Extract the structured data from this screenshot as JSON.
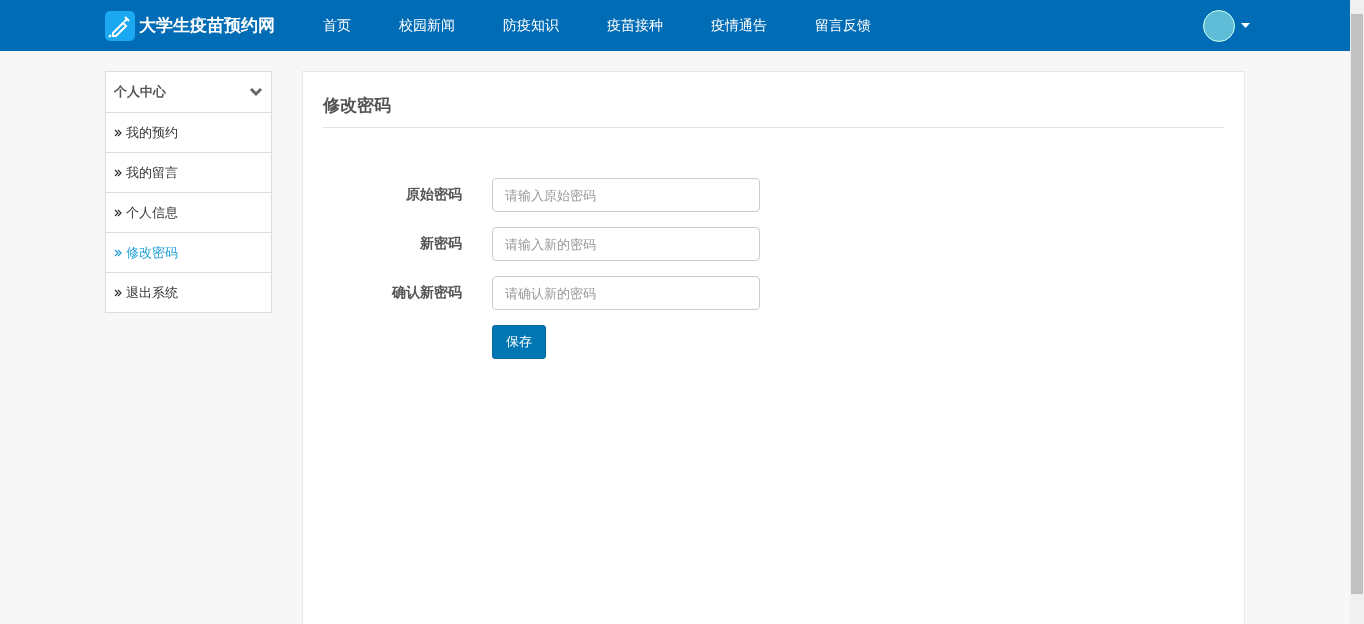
{
  "header": {
    "brand": "大学生疫苗预约网",
    "nav": [
      {
        "label": "首页"
      },
      {
        "label": "校园新闻"
      },
      {
        "label": "防疫知识"
      },
      {
        "label": "疫苗接种"
      },
      {
        "label": "疫情通告"
      },
      {
        "label": "留言反馈"
      }
    ]
  },
  "sidebar": {
    "title": "个人中心",
    "expanded": true,
    "items": [
      {
        "label": "我的预约",
        "selected": false
      },
      {
        "label": "我的留言",
        "selected": false
      },
      {
        "label": "个人信息",
        "selected": false
      },
      {
        "label": "修改密码",
        "selected": true
      },
      {
        "label": "退出系统",
        "selected": false
      }
    ]
  },
  "panel": {
    "title": "修改密码",
    "fields": [
      {
        "label": "原始密码",
        "placeholder": "请输入原始密码"
      },
      {
        "label": "新密码",
        "placeholder": "请输入新的密码"
      },
      {
        "label": "确认新密码",
        "placeholder": "请确认新的密码"
      }
    ],
    "button": "保存"
  }
}
